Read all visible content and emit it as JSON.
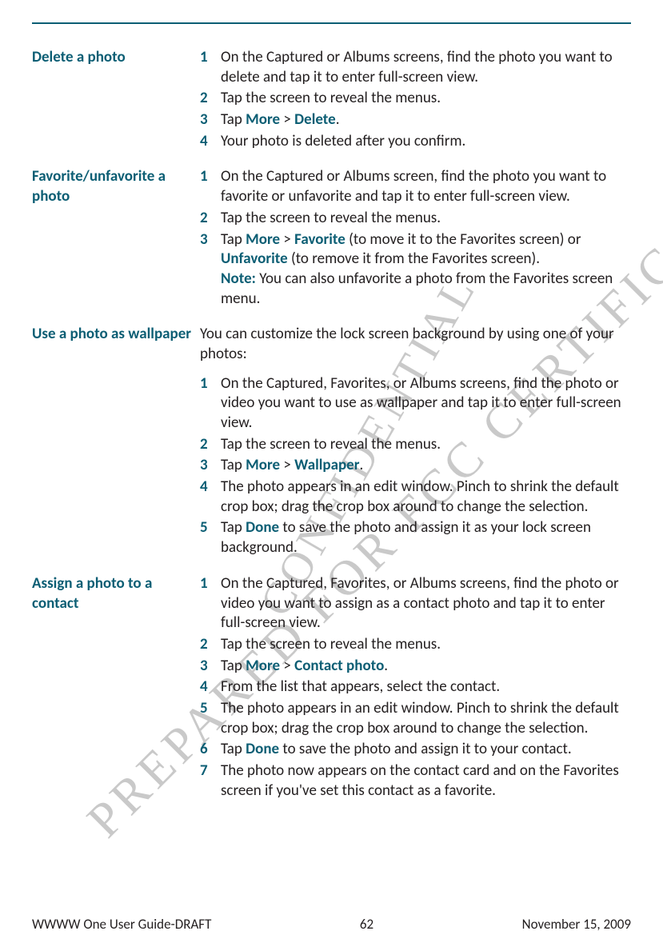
{
  "watermarks": {
    "w1": "PREPARED FOR FCC CERTIFICATION",
    "w2": "CONFIDENTIAL"
  },
  "sections": [
    {
      "title": "Delete a photo",
      "intro": "",
      "steps": [
        {
          "html": "On the Captured or Albums screens, find the photo you want to delete and tap it to enter full-screen view."
        },
        {
          "html": "Tap the screen to reveal the menus."
        },
        {
          "html": "Tap <span class=\"kw\">More</span> > <span class=\"kw\">Delete</span>."
        },
        {
          "html": "Your photo is deleted after you confirm."
        }
      ]
    },
    {
      "title": "Favorite/unfavorite a photo",
      "intro": "",
      "steps": [
        {
          "html": "On the Captured or Albums screen, find the photo you want to favorite or unfavorite and tap it to enter full-screen view."
        },
        {
          "html": "Tap the screen to reveal the menus."
        },
        {
          "html": "Tap <span class=\"kw\">More</span> > <span class=\"kw\">Favorite</span> (to move it to the Favorites screen) or <span class=\"kw\">Unfavorite</span> (to remove it from the Favorites screen).<br><span class=\"kw\">Note:</span> You can also unfavorite a photo from the Favorites screen menu."
        }
      ]
    },
    {
      "title": "Use a photo as wallpaper",
      "intro": "You can customize the lock screen background by using one of your photos:",
      "steps": [
        {
          "html": "On the Captured, Favorites, or Albums screens, find the photo or video you want to use as wallpaper and tap it to enter full-screen view."
        },
        {
          "html": "Tap the screen to reveal the menus."
        },
        {
          "html": "Tap <span class=\"kw\">More</span> > <span class=\"kw\">Wallpaper</span>."
        },
        {
          "html": "The photo appears in an edit window. Pinch to shrink the default crop box; drag the crop box around to change the selection."
        },
        {
          "html": "Tap <span class=\"kw\">Done</span> to save the photo and assign it as your lock screen background."
        }
      ]
    },
    {
      "title": "Assign a photo to a contact",
      "intro": "",
      "steps": [
        {
          "html": "On the Captured, Favorites, or Albums screens, find the photo or video you want to assign as a contact photo and tap it to enter full-screen view."
        },
        {
          "html": "Tap the screen to reveal the menus."
        },
        {
          "html": "Tap <span class=\"kw\">More</span> > <span class=\"kw\">Contact photo</span>."
        },
        {
          "html": "From the list that appears, select the contact."
        },
        {
          "html": "The photo appears in an edit window. Pinch to shrink the default crop box; drag the crop box around to change the selection."
        },
        {
          "html": "Tap <span class=\"kw\">Done</span> to save the photo and assign it to your contact."
        },
        {
          "html": "The photo now appears on the contact card and on the Favorites screen if you've set this contact as a favorite."
        }
      ]
    }
  ],
  "footer": {
    "left": "WWWW One User Guide-DRAFT",
    "center": "62",
    "right": "November 15, 2009"
  }
}
